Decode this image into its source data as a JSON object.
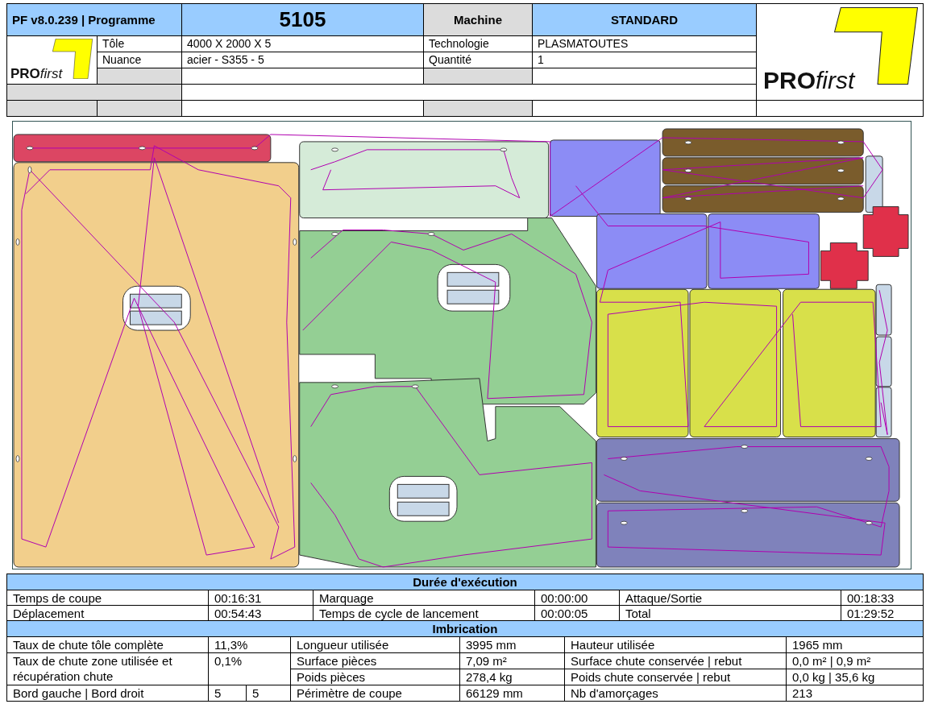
{
  "header": {
    "version": "PF v8.0.239 | Programme",
    "program": "5105",
    "machine_label": "Machine",
    "machine": "STANDARD",
    "fields": [
      {
        "label": "Tôle",
        "value": " 4000 X 2000 X 5",
        "label2": "Technologie",
        "value2": "PLASMATOUTES"
      },
      {
        "label": "Nuance",
        "value": "acier - S355 - 5",
        "label2": "Quantité",
        "value2": "1"
      }
    ],
    "logo_small": {
      "bold": "PRO",
      "light": "first"
    },
    "logo_large": {
      "bold": "PRO",
      "light": "first"
    }
  },
  "execution": {
    "title": "Durée d'exécution",
    "rows": [
      [
        "Temps de coupe",
        "00:16:31",
        "Marquage",
        "00:00:00",
        "Attaque/Sortie",
        "00:18:33"
      ],
      [
        "Déplacement",
        "00:54:43",
        "Temps de cycle de lancement",
        "00:00:05",
        "Total",
        "01:29:52"
      ]
    ]
  },
  "imbrication": {
    "title": "Imbrication",
    "rows": [
      [
        "Taux de chute tôle complète",
        "11,3%",
        "",
        "Longueur utilisée",
        "3995 mm",
        "Hauteur utilisée",
        "1965 mm"
      ],
      [
        "Taux de chute zone utilisée et récupération chute",
        "0,1%",
        "",
        "Surface pièces",
        "7,09 m²",
        "Surface chute conservée | rebut",
        "0,0 m² | 0,9 m²"
      ],
      [
        "",
        "",
        "",
        "Poids pièces",
        "278,4 kg",
        "Poids chute conservée | rebut",
        "0,0 kg | 35,6 kg"
      ],
      [
        "Bord gauche | Bord droit",
        "5",
        "5",
        "Périmètre de coupe",
        "66129 mm",
        "Nb d'amorçages",
        "213"
      ]
    ]
  }
}
